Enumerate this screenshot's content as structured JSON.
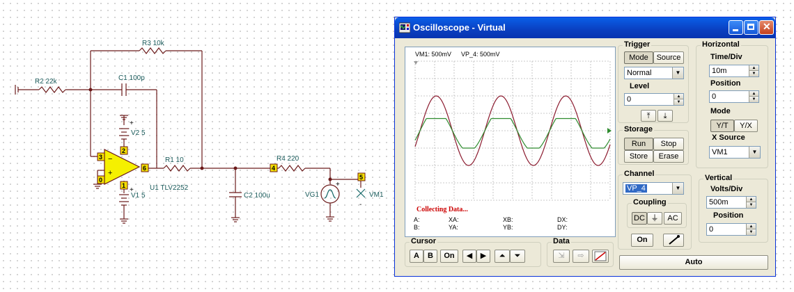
{
  "schematic": {
    "r3": "R3 10k",
    "r2": "R2 22k",
    "c1": "C1 100p",
    "v2": "V2 5",
    "v1": "V1 5",
    "r1": "R1 10",
    "u1": "U1 TLV2252",
    "c2": "C2 100u",
    "r4": "R4 220",
    "vg1": "VG1",
    "vm1": "VM1",
    "pins": {
      "p3": "3",
      "p2": "2",
      "p6": "6",
      "p0": "0",
      "p1": "1",
      "p4": "4",
      "p5": "5"
    }
  },
  "window": {
    "title": "Oscilloscope - Virtual"
  },
  "display": {
    "vm1_label": "VM1: 500mV",
    "vp4_label": "VP_4: 500mV",
    "status": "Collecting Data...",
    "cursors": {
      "a": "A:",
      "b": "B:",
      "xa": "XA:",
      "ya": "YA:",
      "xb": "XB:",
      "yb": "YB:",
      "dx": "DX:",
      "dy": "DY:"
    },
    "colors": {
      "vm1": "#8b1a2e",
      "vp4": "#2e8b2e",
      "grid": "#b9b9b9"
    }
  },
  "trigger": {
    "title": "Trigger",
    "mode": "Mode",
    "source": "Source",
    "mode_value": "Normal",
    "level_label": "Level",
    "level_value": "0"
  },
  "storage": {
    "title": "Storage",
    "run": "Run",
    "stop": "Stop",
    "store": "Store",
    "erase": "Erase"
  },
  "channel": {
    "title": "Channel",
    "value": "VP_4",
    "coupling_label": "Coupling",
    "dc": "DC",
    "gnd": "⏚",
    "ac": "AC",
    "on": "On"
  },
  "horizontal": {
    "title": "Horizontal",
    "timediv_label": "Time/Div",
    "timediv_value": "10m",
    "position_label": "Position",
    "position_value": "0",
    "mode_label": "Mode",
    "yt": "Y/T",
    "yx": "Y/X",
    "xsource_label": "X Source",
    "xsource_value": "VM1"
  },
  "vertical": {
    "title": "Vertical",
    "voltsdiv_label": "Volts/Div",
    "voltsdiv_value": "500m",
    "position_label": "Position",
    "position_value": "0"
  },
  "cursor_group": {
    "title": "Cursor",
    "a": "A",
    "b": "B",
    "on": "On"
  },
  "data_group": {
    "title": "Data"
  },
  "auto": "Auto"
}
